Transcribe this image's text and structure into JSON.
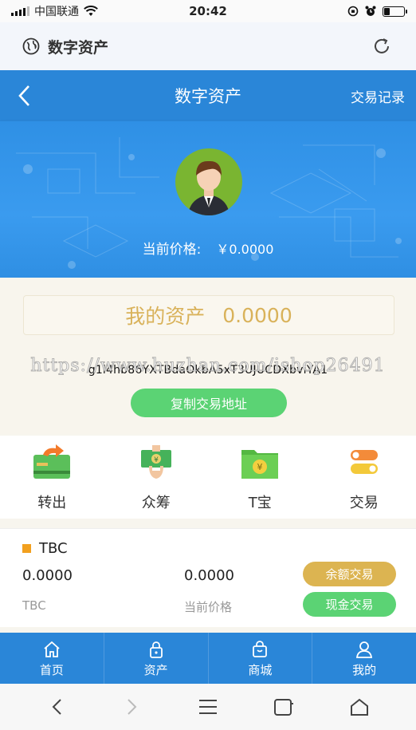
{
  "status_bar": {
    "carrier": "中国联通",
    "time": "20:42",
    "battery_level": 0.3
  },
  "browser": {
    "title": "数字资产"
  },
  "nav": {
    "title": "数字资产",
    "right_label": "交易记录"
  },
  "hero": {
    "price_label": "当前价格:",
    "price_value": "￥0.0000"
  },
  "assets": {
    "label": "我的资产",
    "value": "0.0000",
    "address": "g1l4hb86YXTBdaOkbA5xT3UJUCDXbviYA1",
    "copy_label": "复制交易地址"
  },
  "actions": [
    {
      "label": "转出",
      "icon": "transfer-card-icon"
    },
    {
      "label": "众筹",
      "icon": "crowdfund-hand-icon"
    },
    {
      "label": "T宝",
      "icon": "tbao-folder-icon"
    },
    {
      "label": "交易",
      "icon": "trade-toggle-icon"
    }
  ],
  "coin": {
    "name": "TBC",
    "balance": "0.0000",
    "balance_sub": "TBC",
    "price": "0.0000",
    "price_sub": "当前价格",
    "btn_balance_trade": "余额交易",
    "btn_cash_trade": "现金交易"
  },
  "tabs": [
    {
      "label": "首页",
      "icon": "home-icon"
    },
    {
      "label": "资产",
      "icon": "lock-icon"
    },
    {
      "label": "商城",
      "icon": "bag-icon"
    },
    {
      "label": "我的",
      "icon": "user-icon"
    }
  ],
  "watermark": "https://www.huzhan.com/ishop26491",
  "colors": {
    "primary": "#2a86d8",
    "gold": "#d9b25a",
    "green": "#5bd374",
    "coin_marker": "#f2a01e"
  }
}
